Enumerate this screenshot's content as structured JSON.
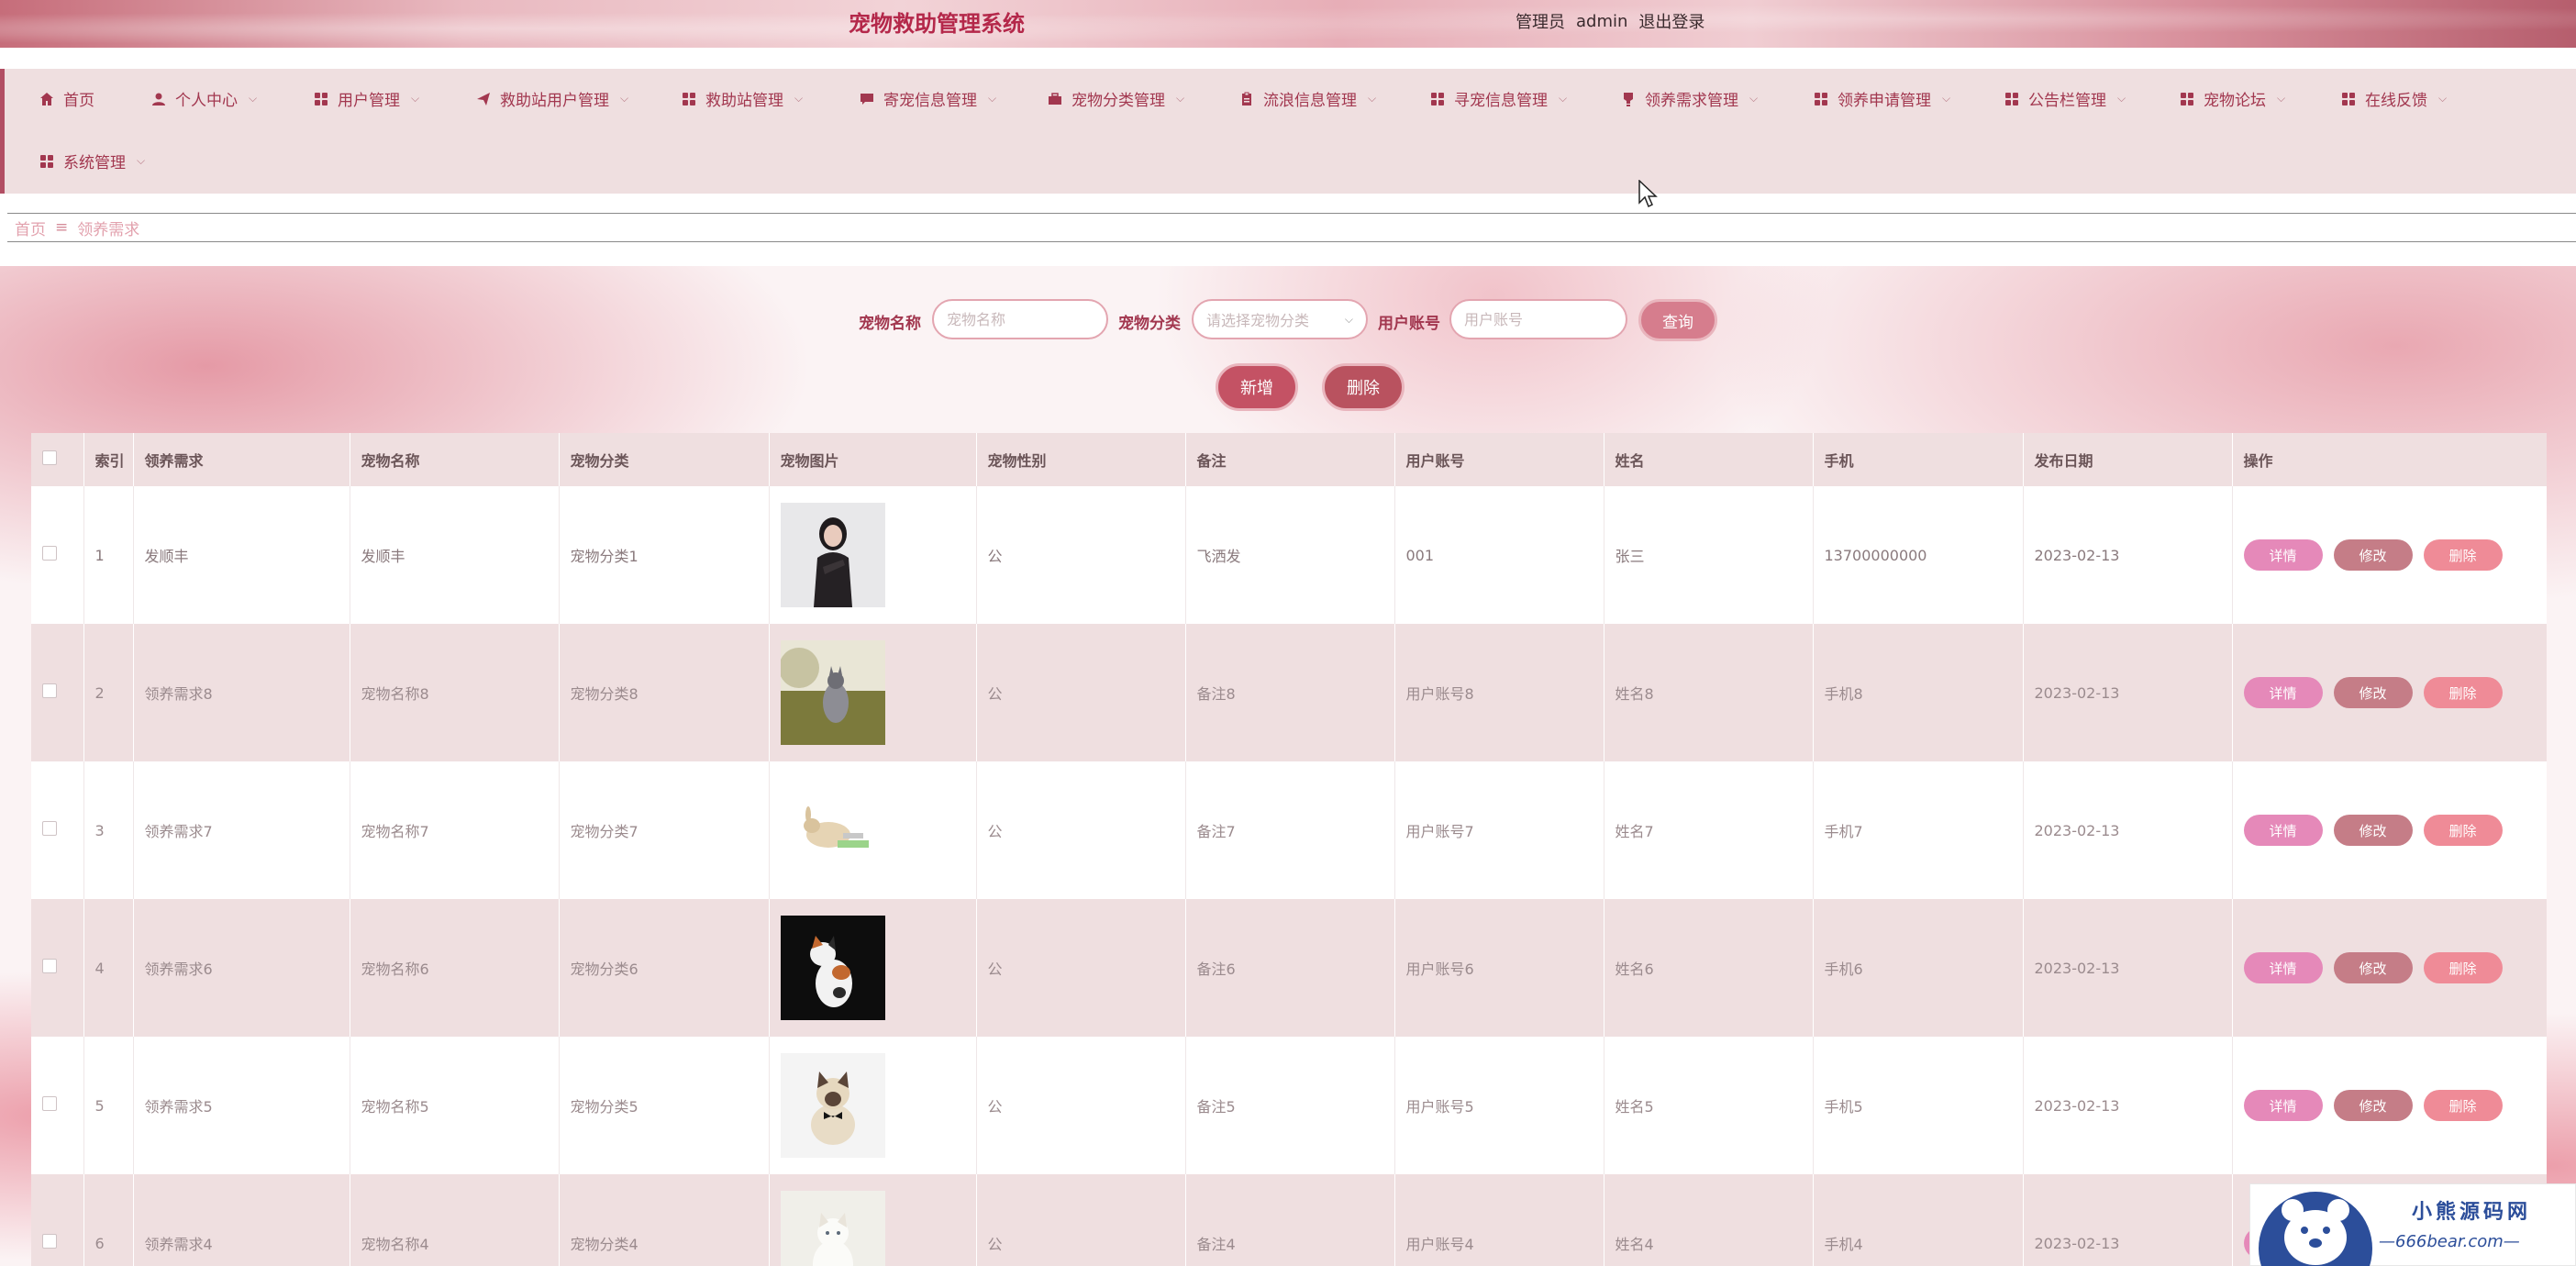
{
  "header": {
    "title": "宠物救助管理系统",
    "role": "管理员",
    "username": "admin",
    "logout": "退出登录"
  },
  "nav": {
    "items": [
      {
        "label": "首页",
        "icon": "home-icon"
      },
      {
        "label": "个人中心",
        "icon": "user-icon"
      },
      {
        "label": "用户管理",
        "icon": "grid-icon"
      },
      {
        "label": "救助站用户管理",
        "icon": "paper-plane-icon"
      },
      {
        "label": "救助站管理",
        "icon": "grid-icon"
      },
      {
        "label": "寄宠信息管理",
        "icon": "chat-icon"
      },
      {
        "label": "宠物分类管理",
        "icon": "briefcase-icon"
      },
      {
        "label": "流浪信息管理",
        "icon": "clipboard-icon"
      },
      {
        "label": "寻宠信息管理",
        "icon": "grid-icon"
      },
      {
        "label": "领养需求管理",
        "icon": "bulb-icon"
      },
      {
        "label": "领养申请管理",
        "icon": "grid-icon"
      },
      {
        "label": "公告栏管理",
        "icon": "grid-icon"
      },
      {
        "label": "宠物论坛",
        "icon": "grid-icon"
      },
      {
        "label": "在线反馈",
        "icon": "grid-icon"
      },
      {
        "label": "系统管理",
        "icon": "grid-icon"
      }
    ]
  },
  "breadcrumb": {
    "home": "首页",
    "separator": "≡",
    "current": "领养需求"
  },
  "search": {
    "pet_name_label": "宠物名称",
    "pet_name_placeholder": "宠物名称",
    "pet_category_label": "宠物分类",
    "pet_category_placeholder": "请选择宠物分类",
    "user_account_label": "用户账号",
    "user_account_placeholder": "用户账号",
    "query_button": "查询"
  },
  "actions": {
    "add_button": "新增",
    "delete_button": "删除"
  },
  "table": {
    "columns": [
      "索引",
      "领养需求",
      "宠物名称",
      "宠物分类",
      "宠物图片",
      "宠物性别",
      "备注",
      "用户账号",
      "姓名",
      "手机",
      "发布日期",
      "操作"
    ],
    "rows": [
      {
        "index": "1",
        "demand": "发顺丰",
        "pet_name": "发顺丰",
        "category": "宠物分类1",
        "gender": "公",
        "remark": "飞洒发",
        "account": "001",
        "name": "张三",
        "phone": "13700000000",
        "date": "2023-02-13"
      },
      {
        "index": "2",
        "demand": "领养需求8",
        "pet_name": "宠物名称8",
        "category": "宠物分类8",
        "gender": "公",
        "remark": "备注8",
        "account": "用户账号8",
        "name": "姓名8",
        "phone": "手机8",
        "date": "2023-02-13"
      },
      {
        "index": "3",
        "demand": "领养需求7",
        "pet_name": "宠物名称7",
        "category": "宠物分类7",
        "gender": "公",
        "remark": "备注7",
        "account": "用户账号7",
        "name": "姓名7",
        "phone": "手机7",
        "date": "2023-02-13"
      },
      {
        "index": "4",
        "demand": "领养需求6",
        "pet_name": "宠物名称6",
        "category": "宠物分类6",
        "gender": "公",
        "remark": "备注6",
        "account": "用户账号6",
        "name": "姓名6",
        "phone": "手机6",
        "date": "2023-02-13"
      },
      {
        "index": "5",
        "demand": "领养需求5",
        "pet_name": "宠物名称5",
        "category": "宠物分类5",
        "gender": "公",
        "remark": "备注5",
        "account": "用户账号5",
        "name": "姓名5",
        "phone": "手机5",
        "date": "2023-02-13"
      },
      {
        "index": "6",
        "demand": "领养需求4",
        "pet_name": "宠物名称4",
        "category": "宠物分类4",
        "gender": "公",
        "remark": "备注4",
        "account": "用户账号4",
        "name": "姓名4",
        "phone": "手机4",
        "date": "2023-02-13"
      }
    ],
    "op_detail": "详情",
    "op_edit": "修改",
    "op_delete": "删除"
  },
  "watermark": {
    "line1": "小熊源码网",
    "line2": "—666bear.com—"
  },
  "colors": {
    "brand": "#b4284a",
    "nav_bg": "#efdfe0",
    "detail_btn": "#e589b9",
    "edit_btn": "#c57d87",
    "delete_btn": "#ef8b97"
  }
}
